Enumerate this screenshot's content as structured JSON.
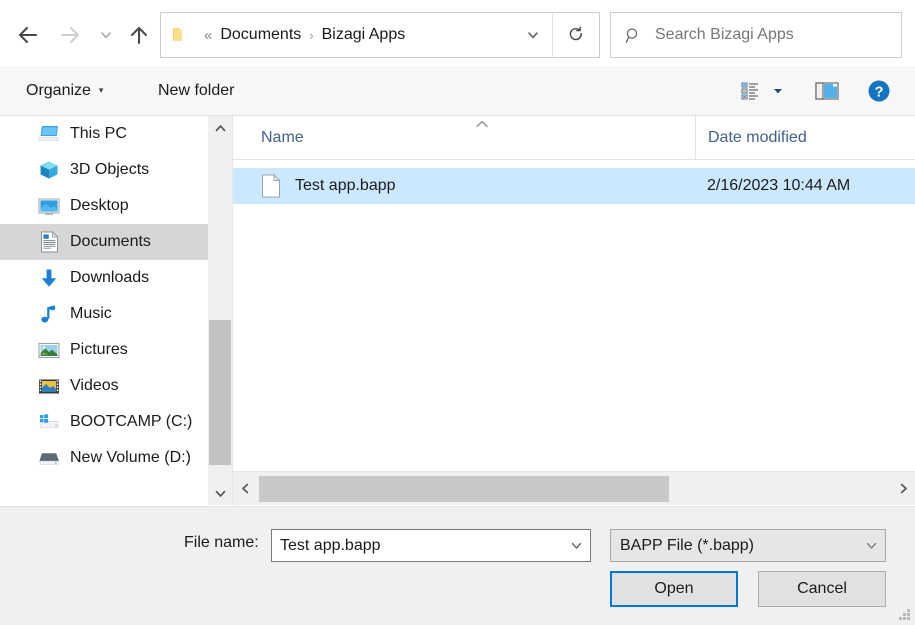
{
  "nav": {
    "back_label": "Back",
    "forward_label": "Forward",
    "recent_label": "Recent locations",
    "up_label": "Up one level"
  },
  "address": {
    "folder_icon": "folder-icon",
    "leading_separator": "«",
    "crumb_separator": "›",
    "crumbs": [
      "Documents",
      "Bizagi Apps"
    ],
    "dropdown_icon": "chevron-down-icon",
    "refresh_icon": "refresh-icon"
  },
  "search": {
    "icon": "search-icon",
    "placeholder": "Search Bizagi Apps",
    "value": ""
  },
  "toolbar": {
    "organize_label": "Organize",
    "organize_caret": "▾",
    "new_folder_label": "New folder",
    "view_icon": "view-list-icon",
    "view_caret": "▾",
    "preview_icon": "preview-pane-icon",
    "help_icon": "help-icon"
  },
  "sidebar": {
    "items": [
      {
        "label": "This PC",
        "icon": "this-pc-icon",
        "selected": false
      },
      {
        "label": "3D Objects",
        "icon": "3d-objects-icon",
        "selected": false
      },
      {
        "label": "Desktop",
        "icon": "desktop-icon",
        "selected": false
      },
      {
        "label": "Documents",
        "icon": "documents-icon",
        "selected": true
      },
      {
        "label": "Downloads",
        "icon": "downloads-icon",
        "selected": false
      },
      {
        "label": "Music",
        "icon": "music-icon",
        "selected": false
      },
      {
        "label": "Pictures",
        "icon": "pictures-icon",
        "selected": false
      },
      {
        "label": "Videos",
        "icon": "videos-icon",
        "selected": false
      },
      {
        "label": "BOOTCAMP (C:)",
        "icon": "drive-windows-icon",
        "selected": false
      },
      {
        "label": "New Volume (D:)",
        "icon": "drive-icon",
        "selected": false
      }
    ],
    "scroll_up_icon": "chevron-up-icon",
    "scroll_down_icon": "chevron-down-icon"
  },
  "filelist": {
    "columns": [
      {
        "label": "Name",
        "sorted": true,
        "sort_icon": "sort-ascending-icon"
      },
      {
        "label": "Date modified",
        "sorted": false
      }
    ],
    "rows": [
      {
        "name": "Test app.bapp",
        "date_modified": "2/16/2023 10:44 AM",
        "icon": "file-icon",
        "selected": true
      }
    ],
    "hscroll_left_icon": "chevron-left-icon",
    "hscroll_right_icon": "chevron-right-icon"
  },
  "bottom": {
    "filename_label": "File name:",
    "filename_value": "Test app.bapp",
    "filename_caret": "chevron-down-icon",
    "filter_value": "BAPP File (*.bapp)",
    "filter_caret": "chevron-down-icon",
    "open_label": "Open",
    "cancel_label": "Cancel",
    "resize_grip": "resize-grip-icon"
  },
  "colors": {
    "accent": "#0078d7",
    "selection_row": "#cce8ff",
    "selection_sidebar": "#d6d6d6",
    "column_header_text": "#41618f",
    "toolbar_bg": "#f7f7f7",
    "bottom_bg": "#f0f0f0"
  }
}
